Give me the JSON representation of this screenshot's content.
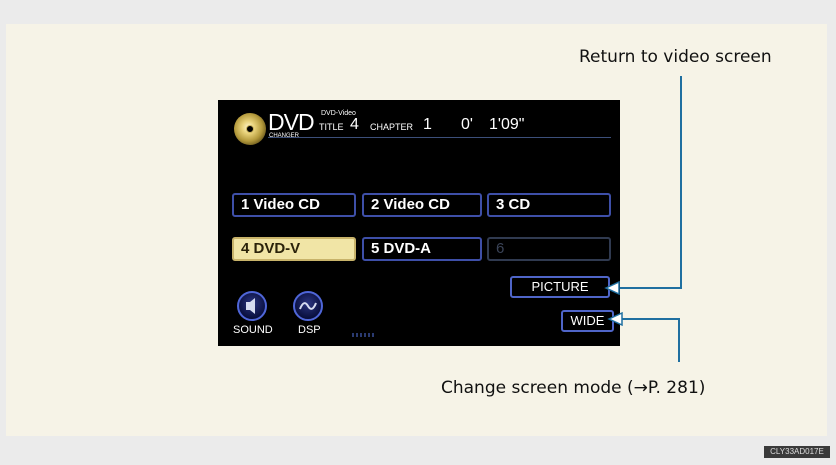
{
  "header": {
    "logo_text": "DVD",
    "logo_sub": "CHANGER",
    "format": "DVD-Video",
    "title_label": "TITLE",
    "title_value": "4",
    "chapter_label": "CHAPTER",
    "chapter_value": "1",
    "time_hours": "0'",
    "time_minutes": "1'09\""
  },
  "discs": [
    {
      "label": "1 Video CD",
      "selected": false
    },
    {
      "label": "2 Video CD",
      "selected": false
    },
    {
      "label": "3 CD",
      "selected": false
    },
    {
      "label": "4 DVD-V",
      "selected": true
    },
    {
      "label": "5 DVD-A",
      "selected": false
    },
    {
      "label": "6",
      "selected": false
    }
  ],
  "buttons": {
    "picture": "PICTURE",
    "wide": "WIDE",
    "sound": "SOUND",
    "dsp": "DSP"
  },
  "annotations": {
    "return": "Return to video screen",
    "change": "Change screen mode (→P. 281)"
  },
  "image_code": "CLY33AD017E",
  "colors": {
    "accent": "#3e4fa8",
    "selected": "#f1e5a6",
    "leader": "#1f6fa0"
  }
}
